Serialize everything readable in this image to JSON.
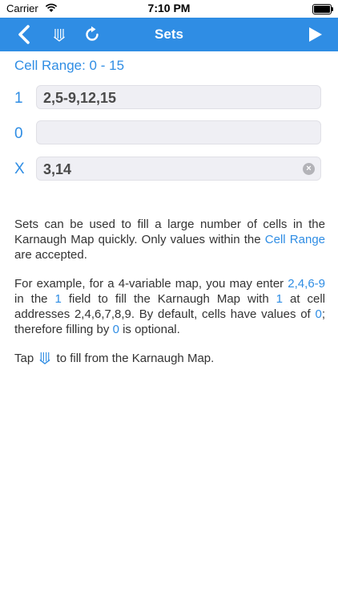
{
  "status_bar": {
    "carrier": "Carrier",
    "time": "7:10 PM"
  },
  "nav": {
    "title": "Sets"
  },
  "cell_range": "Cell Range: 0 - 15",
  "rows": [
    {
      "label": "1",
      "value": "2,5-9,12,15"
    },
    {
      "label": "0",
      "value": ""
    },
    {
      "label": "X",
      "value": "3,14"
    }
  ],
  "help": {
    "p1": {
      "a": "Sets can be used to fill a large number of cells in the Karnaugh Map quickly. Only values within the ",
      "link": "Cell Range",
      "b": " are accepted."
    },
    "p2": {
      "a": "For example, for a 4-variable map, you may enter ",
      "h1": "2,4,6-9",
      "b": " in the ",
      "h2": "1",
      "c": " field to fill the Karnaugh Map with ",
      "h3": "1",
      "d": " at cell addresses 2,4,6,7,8,9. By default, cells have values of ",
      "h4": "0",
      "e": "; therefore filling by ",
      "h5": "0",
      "f": " is optional."
    },
    "p3": {
      "a": "Tap ",
      "b": " to fill from the Karnaugh Map."
    }
  },
  "colors": {
    "accent": "#2f8de4",
    "nav_bg": "#2f8de4",
    "field_bg": "#efeff4"
  },
  "icons": {
    "back": "chevron-left-icon",
    "fill": "down-arrows-icon",
    "reset": "refresh-icon",
    "play": "play-icon",
    "clear": "clear-icon"
  }
}
